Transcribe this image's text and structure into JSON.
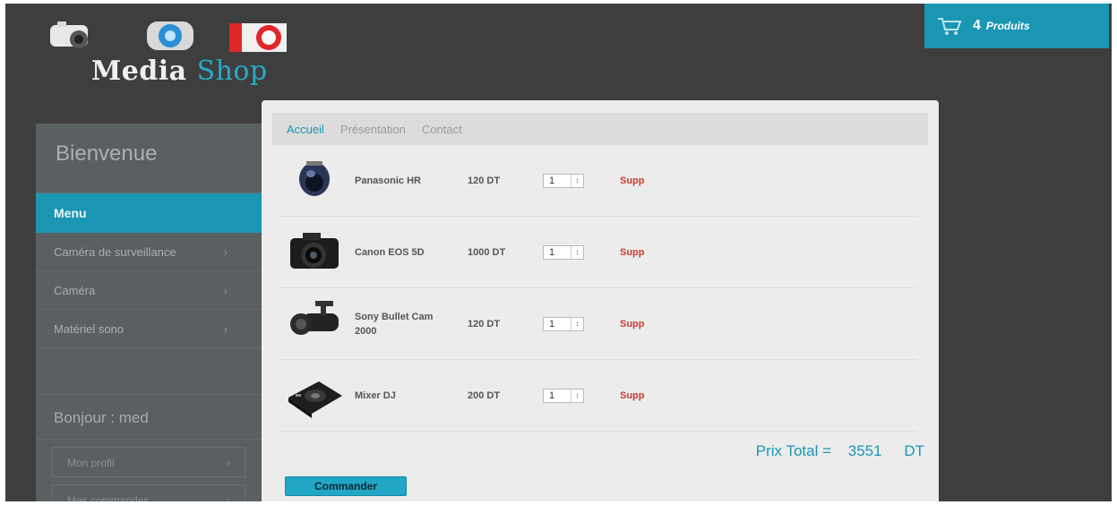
{
  "logo": {
    "word1": "Media",
    "word2": "Shop"
  },
  "cart": {
    "count": "4",
    "label": "Produits",
    "icon": "cart-icon"
  },
  "sidebar": {
    "welcome": "Bienvenue",
    "menu_title": "Menu",
    "items": [
      {
        "label": "Caméra de surveillance",
        "arrow": "›"
      },
      {
        "label": "Caméra",
        "arrow": "›"
      },
      {
        "label": "Matériel sono",
        "arrow": "›"
      }
    ],
    "hello": "Bonjour : med",
    "sub_items": [
      {
        "label": "Mon profil",
        "arrow": "›"
      },
      {
        "label": "Mes commandes",
        "arrow": "›"
      }
    ]
  },
  "tabs": [
    {
      "label": "Accueil",
      "active": true
    },
    {
      "label": "Présentation",
      "active": false
    },
    {
      "label": "Contact",
      "active": false
    }
  ],
  "products": [
    {
      "name": "Panasonic HR",
      "price": "120 DT",
      "qty": "1",
      "delete": "Supp",
      "icon": "dome-camera-icon"
    },
    {
      "name": "Canon EOS 5D",
      "price": "1000 DT",
      "qty": "1",
      "delete": "Supp",
      "icon": "dslr-camera-icon"
    },
    {
      "name": "Sony Bullet Cam 2000",
      "price": "120 DT",
      "qty": "1",
      "delete": "Supp",
      "icon": "bullet-camera-icon"
    },
    {
      "name": "Mixer DJ",
      "price": "200 DT",
      "qty": "1",
      "delete": "Supp",
      "icon": "dj-mixer-icon"
    }
  ],
  "total": {
    "label": "Prix Total =",
    "amount": "3551",
    "currency": "DT"
  },
  "order_button": "Commander",
  "colors": {
    "accent": "#1a96b3",
    "background": "#3e3e3e",
    "sidebar": "#5a5f62",
    "danger": "#d0392f"
  }
}
